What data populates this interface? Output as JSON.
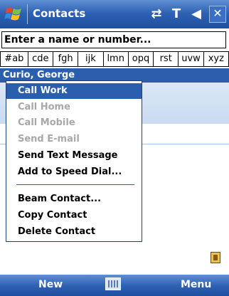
{
  "titlebar": {
    "title": "Contacts",
    "icons": [
      "windows-logo",
      "connectivity-icon",
      "signal-icon",
      "volume-icon",
      "close-icon"
    ]
  },
  "search": {
    "value": "Enter a name or number..."
  },
  "alpha_tabs": [
    "#ab",
    "cde",
    "fgh",
    "ijk",
    "lmn",
    "opq",
    "rst",
    "uvw",
    "xyz"
  ],
  "contact": {
    "name": "Curio, George"
  },
  "context_menu": {
    "items": [
      {
        "label": "Call Work",
        "state": "highlighted"
      },
      {
        "label": "Call Home",
        "state": "disabled"
      },
      {
        "label": "Call Mobile",
        "state": "disabled"
      },
      {
        "label": "Send E-mail",
        "state": "disabled"
      },
      {
        "label": "Send Text Message",
        "state": "enabled"
      },
      {
        "label": "Add to Speed Dial...",
        "state": "enabled"
      },
      {
        "label": "Beam Contact...",
        "state": "enabled"
      },
      {
        "label": "Copy Contact",
        "state": "enabled"
      },
      {
        "label": "Delete Contact",
        "state": "enabled"
      }
    ]
  },
  "softkeys": {
    "left": "New",
    "right": "Menu"
  },
  "colors": {
    "accent": "#2b5fad",
    "disabled_text": "#a8a8a8"
  }
}
